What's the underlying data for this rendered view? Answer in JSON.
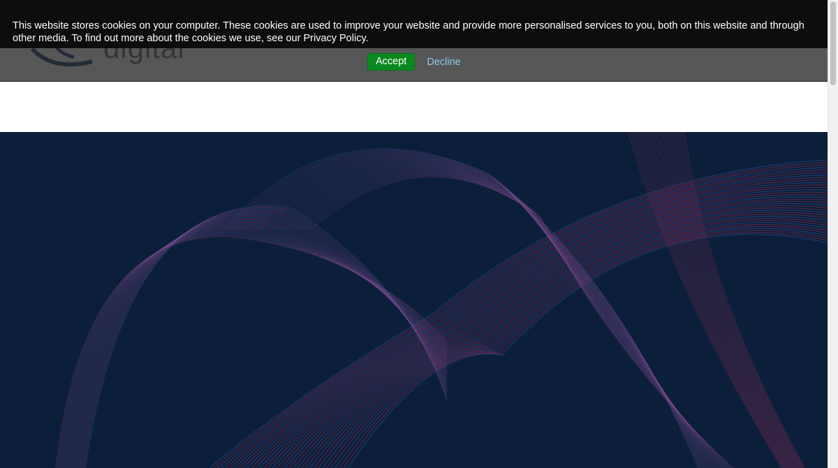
{
  "header": {
    "logo_text": "digital"
  },
  "cookie_banner": {
    "message": "This website stores cookies on your computer. These cookies are used to improve your website and provide more personalised services to you, both on this website and through other media. To find out more about the cookies we use, see our Privacy Policy.",
    "accept_label": "Accept",
    "decline_label": "Decline"
  },
  "colors": {
    "banner_bg": "#0a0a0a",
    "accept_bg": "#0a8a1e",
    "decline_link": "#8fc8e8",
    "hero_bg": "#0c1f3a",
    "wave_pink": "#b0305e",
    "wave_blue": "#3a64b8"
  },
  "icons": {
    "logo": "swoosh-logo-icon"
  }
}
